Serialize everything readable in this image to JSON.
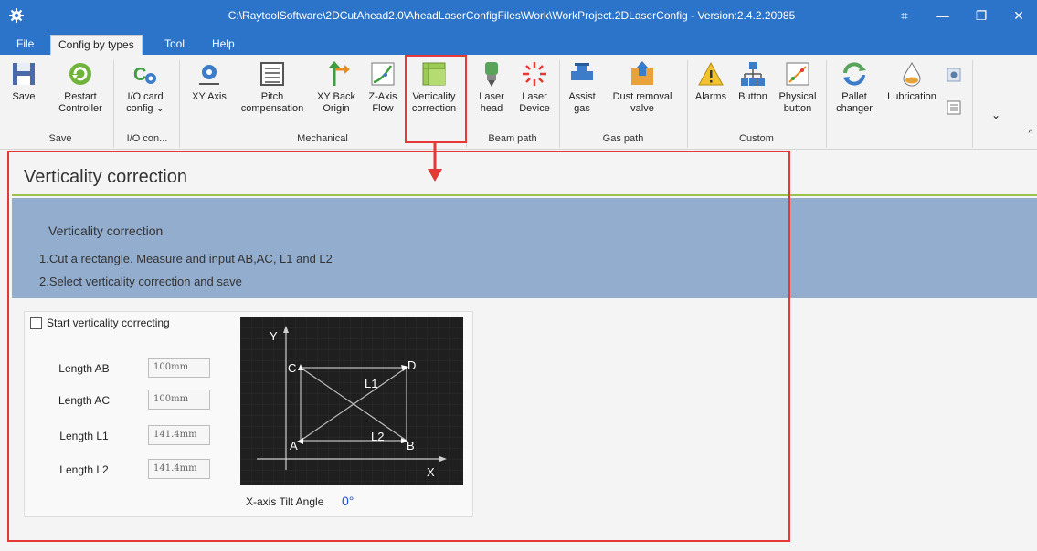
{
  "window": {
    "title": "C:\\RaytoolSoftware\\2DCutAhead2.0\\AheadLaserConfigFiles\\Work\\WorkProject.2DLaserConfig - Version:2.4.2.20985",
    "buttons": [
      "restore-icon",
      "minimize-icon",
      "maximize-icon",
      "close-icon"
    ]
  },
  "menu": {
    "items": [
      "File",
      "Config by types",
      "Tool",
      "Help"
    ],
    "active": "Config by types"
  },
  "ribbon": {
    "buttons": {
      "save": "Save",
      "restart": "Restart Controller",
      "io_card": "I/O card config",
      "xy_axis": "XY Axis",
      "pitch": "Pitch compensation",
      "xy_back": "XY Back Origin",
      "z_axis": "Z-Axis Flow",
      "verticality": "Verticality correction",
      "laser_head": "Laser head",
      "laser_device": "Laser Device",
      "assist_gas": "Assist gas",
      "dust_removal": "Dust removal valve",
      "alarms": "Alarms",
      "button": "Button",
      "physical_button": "Physical button",
      "pallet": "Pallet changer",
      "lubrication": "Lubrication"
    },
    "groups": {
      "save": "Save",
      "io": "I/O con...",
      "mechanical": "Mechanical",
      "beam": "Beam path",
      "gas": "Gas path",
      "custom": "Custom"
    }
  },
  "page": {
    "title": "Verticality correction",
    "info_heading": "Verticality correction",
    "step1": "1.Cut a rectangle. Measure and input AB,AC, L1 and L2",
    "step2": "2.Select verticality correction and save",
    "checkbox_label": "Start verticality correcting",
    "checkbox_checked": false,
    "fields": [
      {
        "label": "Length AB",
        "value": "100mm"
      },
      {
        "label": "Length AC",
        "value": "100mm"
      },
      {
        "label": "Length L1",
        "value": "141.4mm"
      },
      {
        "label": "Length L2",
        "value": "141.4mm"
      }
    ],
    "diagram": {
      "y": "Y",
      "x": "X",
      "a": "A",
      "b": "B",
      "c": "C",
      "d": "D",
      "l1": "L1",
      "l2": "L2"
    },
    "tilt_label": "X-axis Tilt Angle",
    "tilt_value": "0°"
  },
  "colors": {
    "titlebar": "#2b74c9",
    "info_band": "#93adcf",
    "accent_rule": "#9bc04b",
    "highlight": "#e53935",
    "tilt_value": "#1f4fd1"
  }
}
